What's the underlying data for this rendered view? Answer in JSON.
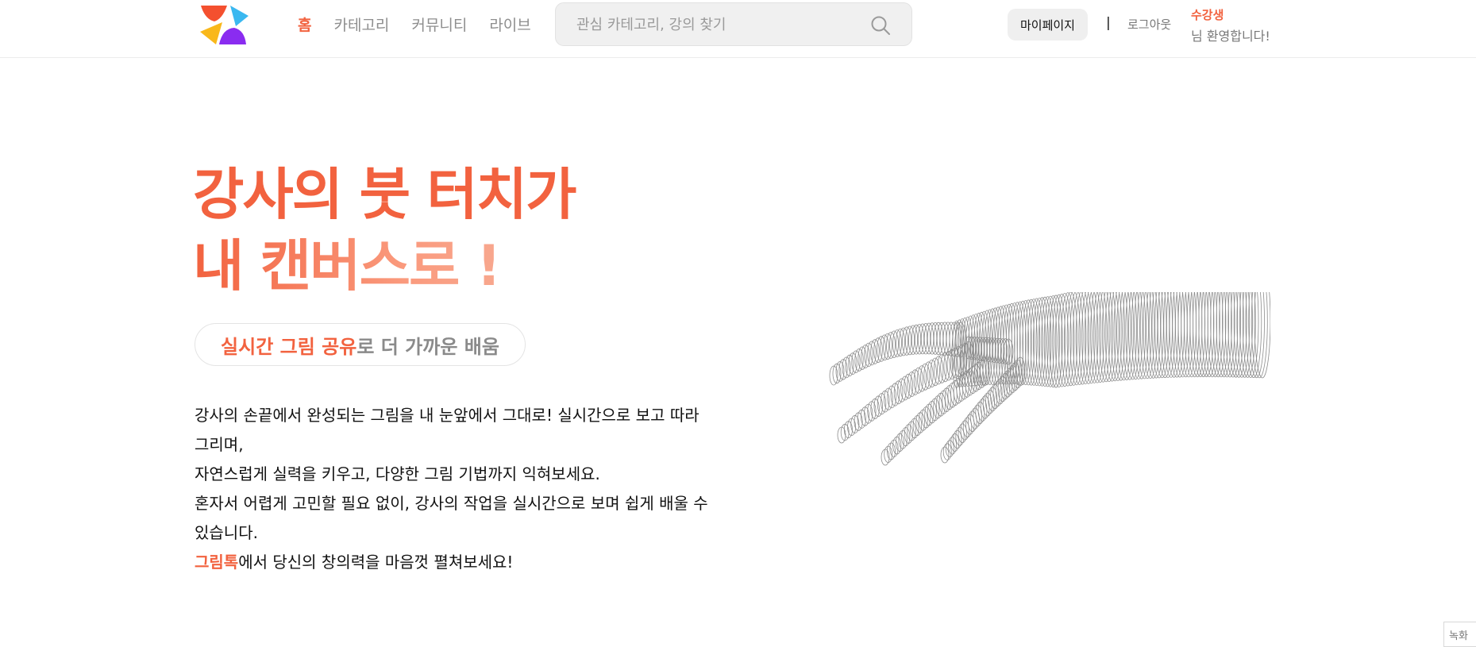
{
  "header": {
    "nav": [
      {
        "label": "홈",
        "active": true
      },
      {
        "label": "카테고리",
        "active": false
      },
      {
        "label": "커뮤니티",
        "active": false
      },
      {
        "label": "라이브",
        "active": false
      }
    ],
    "search": {
      "placeholder": "관심 카테고리, 강의 찾기",
      "value": ""
    },
    "mypage_label": "마이페이지",
    "divider": "|",
    "logout_label": "로그아웃",
    "user_name": "수강생",
    "welcome_suffix": "님 환영합니다!"
  },
  "hero": {
    "title_line1": "강사의 붓 터치가",
    "title_line2": "내 캔버스로 !",
    "pill_highlight": "실시간 그림 공유",
    "pill_rest": "로 더 가까운 배움",
    "desc_line1": "강사의 손끝에서 완성되는 그림을 내 눈앞에서 그대로! 실시간으로 보고 따라",
    "desc_line2": "그리며,",
    "desc_line3": "자연스럽게 실력을 키우고, 다양한 그림 기법까지 익혀보세요.",
    "desc_line4": "혼자서 어렵게 고민할 필요 없이, 강사의 작업을 실시간으로 보며 쉽게 배울 수",
    "desc_line5": "있습니다.",
    "desc_brand": "그림톡",
    "desc_line6_rest": "에서 당신의 창의력을 마음껏 펼쳐보세요!"
  },
  "record_label": "녹화",
  "colors": {
    "accent": "#f2623f",
    "accent_light": "#fa9a7d",
    "logo_red": "#f4502f",
    "logo_blue": "#3ab8f0",
    "logo_yellow": "#f9b81b",
    "logo_purple": "#8a2cf0"
  },
  "icons": {
    "logo": "grimtalk-logo",
    "search": "search-icon",
    "hand": "wireframe-hand-illustration"
  }
}
